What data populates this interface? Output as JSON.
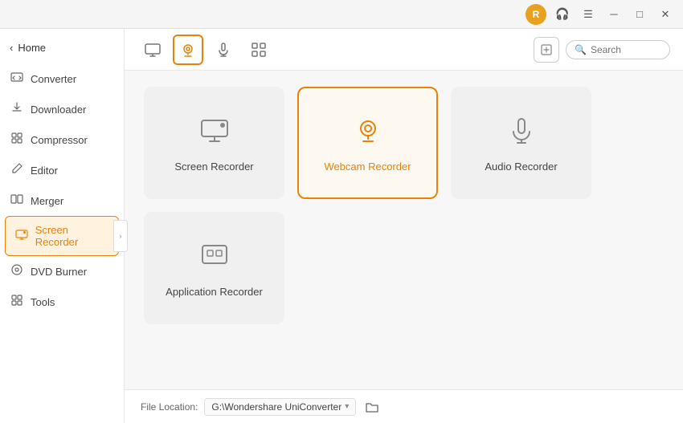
{
  "titlebar": {
    "avatar_initial": "R",
    "min_label": "─",
    "max_label": "□",
    "close_label": "✕",
    "menu_label": "☰"
  },
  "sidebar": {
    "home_label": "Home",
    "items": [
      {
        "id": "converter",
        "label": "Converter",
        "icon": "converter"
      },
      {
        "id": "downloader",
        "label": "Downloader",
        "icon": "downloader"
      },
      {
        "id": "compressor",
        "label": "Compressor",
        "icon": "compressor"
      },
      {
        "id": "editor",
        "label": "Editor",
        "icon": "editor"
      },
      {
        "id": "merger",
        "label": "Merger",
        "icon": "merger"
      },
      {
        "id": "screen-recorder",
        "label": "Screen Recorder",
        "icon": "screen-recorder",
        "active": true
      },
      {
        "id": "dvd-burner",
        "label": "DVD Burner",
        "icon": "dvd-burner"
      },
      {
        "id": "tools",
        "label": "Tools",
        "icon": "tools"
      }
    ]
  },
  "toolbar": {
    "tabs": [
      {
        "id": "screen",
        "icon": "screen"
      },
      {
        "id": "webcam",
        "icon": "webcam",
        "active": true
      },
      {
        "id": "audio",
        "icon": "audio"
      },
      {
        "id": "apps",
        "icon": "apps"
      }
    ],
    "search_placeholder": "Search"
  },
  "recorders": [
    {
      "id": "screen-recorder",
      "label": "Screen Recorder",
      "icon": "screen",
      "selected": false
    },
    {
      "id": "webcam-recorder",
      "label": "Webcam Recorder",
      "icon": "webcam",
      "selected": true
    },
    {
      "id": "audio-recorder",
      "label": "Audio Recorder",
      "icon": "audio",
      "selected": false
    },
    {
      "id": "application-recorder",
      "label": "Application Recorder",
      "icon": "app",
      "selected": false
    }
  ],
  "file_location": {
    "label": "File Location:",
    "path": "G:\\Wondershare UniConverter`"
  }
}
